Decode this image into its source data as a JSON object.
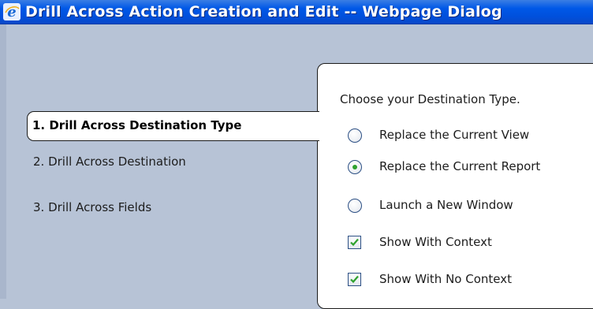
{
  "window": {
    "title": "Drill Across Action Creation and Edit -- Webpage Dialog"
  },
  "steps": [
    {
      "label": "1. Drill Across Destination Type",
      "active": true
    },
    {
      "label": "2. Drill Across Destination",
      "active": false
    },
    {
      "label": "3. Drill Across Fields",
      "active": false
    }
  ],
  "main": {
    "prompt": "Choose your Destination Type.",
    "radios": [
      {
        "label": "Replace the Current View",
        "checked": false
      },
      {
        "label": "Replace the Current Report",
        "checked": true
      },
      {
        "label": "Launch a New Window",
        "checked": false
      }
    ],
    "checkboxes": [
      {
        "label": "Show With Context",
        "checked": true
      },
      {
        "label": "Show With No Context",
        "checked": true
      }
    ]
  },
  "colors": {
    "titlebar": "#0058e7",
    "panel": "#b7c3d6",
    "check": "#2ea12e"
  }
}
